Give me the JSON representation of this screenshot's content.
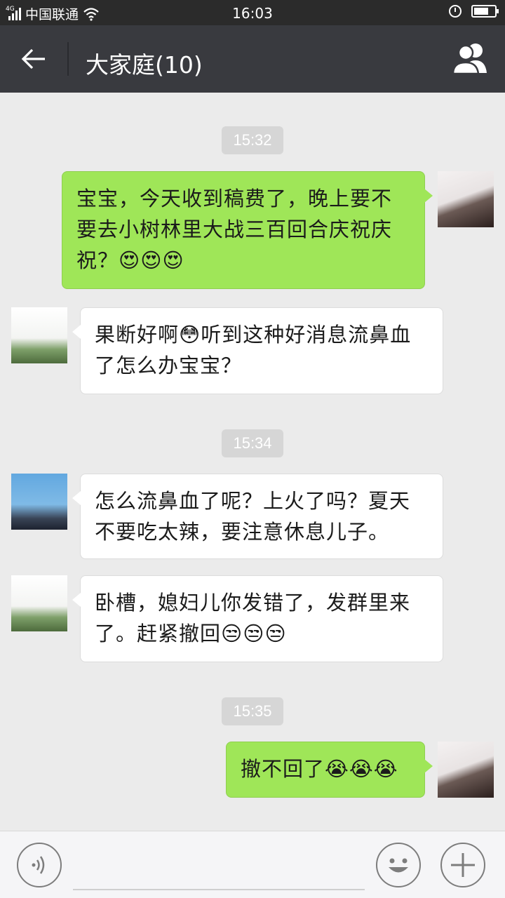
{
  "status_bar": {
    "network": "4G",
    "carrier": "中国联通",
    "time": "16:03"
  },
  "header": {
    "title": "大家庭(10)"
  },
  "messages": [
    {
      "kind": "time",
      "text": "15:32"
    },
    {
      "kind": "out",
      "sender": "me",
      "text": "宝宝，今天收到稿费了，晚上要不要去小树林里大战三百回合庆祝庆祝？😍😍😍"
    },
    {
      "kind": "in",
      "sender": "husband",
      "text": "果断好啊😳听到这种好消息流鼻血了怎么办宝宝？"
    },
    {
      "kind": "time",
      "text": "15:34"
    },
    {
      "kind": "in",
      "sender": "son",
      "text": "怎么流鼻血了呢？上火了吗？夏天不要吃太辣，要注意休息儿子。"
    },
    {
      "kind": "in",
      "sender": "husband",
      "text": "卧槽，媳妇儿你发错了，发群里来了。赶紧撤回😒😒😒"
    },
    {
      "kind": "time",
      "text": "15:35"
    },
    {
      "kind": "out",
      "sender": "me",
      "text": "撤不回了😭😭😭"
    }
  ],
  "colors": {
    "outgoing_bubble": "#9fe658",
    "incoming_bubble": "#ffffff",
    "title_bar": "#393a3f",
    "chat_background": "#ebebeb"
  },
  "icons": {
    "back": "arrow-left-icon",
    "members": "group-members-icon",
    "voice": "voice-icon",
    "emoji": "emoji-icon",
    "more": "plus-icon"
  }
}
